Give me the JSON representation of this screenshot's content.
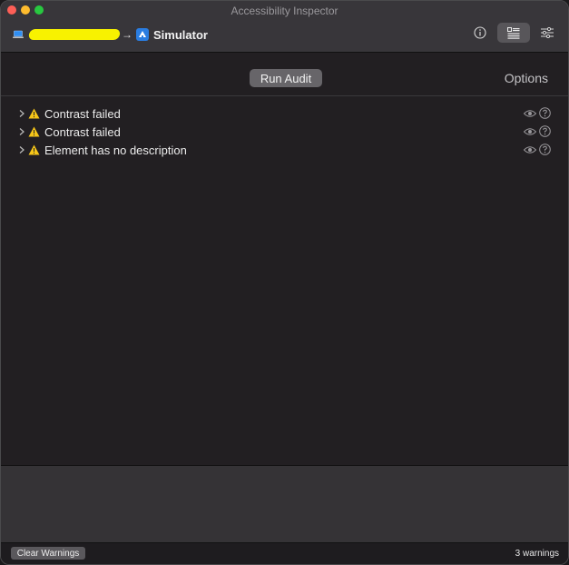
{
  "window": {
    "title": "Accessibility Inspector"
  },
  "toolbar": {
    "target_label": "Simulator",
    "icons": [
      "laptop-icon",
      "arrow-icon",
      "simulator-icon",
      "info-icon",
      "audit-icon",
      "settings-icon"
    ],
    "selected_tool": "audit"
  },
  "audit": {
    "run_button_label": "Run Audit",
    "options_label": "Options"
  },
  "warnings": [
    {
      "label": "Contrast failed"
    },
    {
      "label": "Contrast failed"
    },
    {
      "label": "Element has no description"
    }
  ],
  "statusbar": {
    "clear_button_label": "Clear Warnings",
    "count_label": "3 warnings"
  },
  "colors": {
    "close": "#fe5f57",
    "minimize": "#febc2e",
    "maximize": "#28c840",
    "warning": "#f5c519",
    "redaction": "#f8f200"
  }
}
